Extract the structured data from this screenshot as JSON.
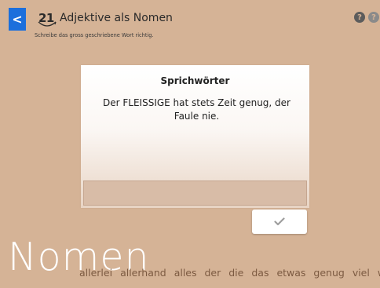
{
  "header": {
    "back_label": "<",
    "lesson_number": "21",
    "lesson_title": "Adjektive als Nomen",
    "instruction": "Schreibe das gross geschriebene Wort richtig."
  },
  "help_icons": [
    "?",
    "?"
  ],
  "card": {
    "title": "Sprichwörter",
    "sentence": "Der FLEISSIGE hat stets Zeit genug, der Faule nie.",
    "answer_value": ""
  },
  "check_button": {
    "icon": "check-icon"
  },
  "category_word": "Nomen",
  "word_strip": [
    "allerlei",
    "allerhand",
    "alles",
    "der",
    "die",
    "das",
    "etwas",
    "genug",
    "viel",
    "wenig"
  ],
  "colors": {
    "background": "#d5b396",
    "back_button": "#1c6fdc",
    "word_strip_text": "#7c5a41"
  }
}
